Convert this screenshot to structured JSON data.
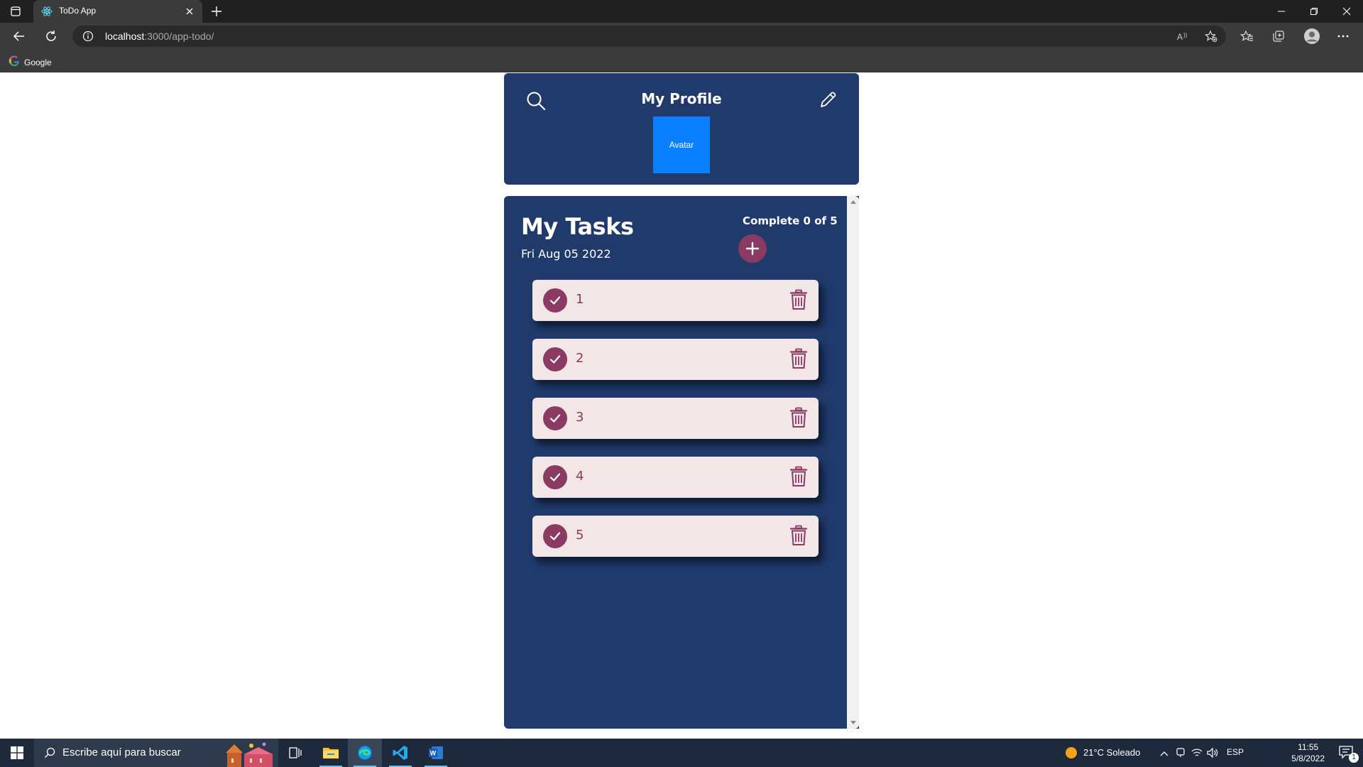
{
  "browser": {
    "tab_title": "ToDo App",
    "url_host": "localhost",
    "url_path": ":3000/app-todo/",
    "bookmark_label": "Google"
  },
  "profile": {
    "title": "My Profile",
    "avatar_label": "Avatar"
  },
  "tasks": {
    "title": "My Tasks",
    "date": "Fri Aug 05 2022",
    "complete_text": "Complete 0 of 5",
    "items": [
      {
        "label": "1"
      },
      {
        "label": "2"
      },
      {
        "label": "3"
      },
      {
        "label": "4"
      },
      {
        "label": "5"
      }
    ]
  },
  "taskbar": {
    "search_placeholder": "Escribe aquí para buscar",
    "weather": "21°C Soleado",
    "language": "ESP",
    "time": "11:55",
    "date": "5/8/2022",
    "notification_count": "1"
  },
  "colors": {
    "panel": "#1f3a6b",
    "accent": "#8a3a63",
    "task_bg": "#f2e6e6",
    "avatar": "#0a7fff"
  }
}
